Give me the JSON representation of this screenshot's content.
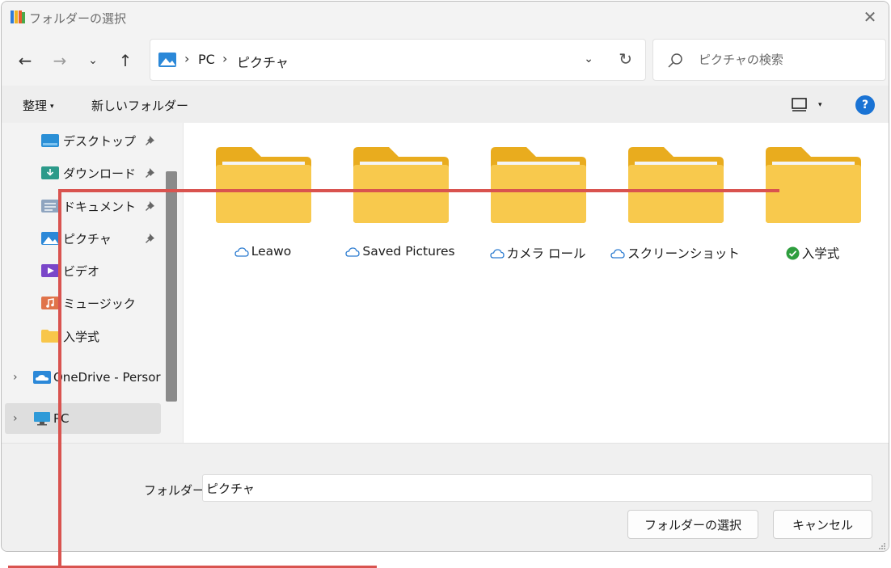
{
  "window": {
    "title": "フォルダーの選択",
    "close_glyph": "✕"
  },
  "nav": {
    "back_glyph": "←",
    "forward_glyph": "→",
    "recent_glyph": "⌄",
    "up_glyph": "↑",
    "breadcrumb": [
      "PC",
      "ピクチャ"
    ],
    "crumb_sep": "›",
    "dropdown_glyph": "⌄",
    "refresh_glyph": "↻",
    "search_placeholder": "ピクチャの検索"
  },
  "toolbar": {
    "organize_label": "整理",
    "organize_caret": "▾",
    "new_folder_label": "新しいフォルダー",
    "view_caret": "▾",
    "help_label": "?"
  },
  "sidebar": {
    "items": [
      {
        "label": "デスクトップ",
        "icon": "desktop-folder-icon",
        "pinned": true
      },
      {
        "label": "ダウンロード",
        "icon": "downloads-folder-icon",
        "pinned": true
      },
      {
        "label": "ドキュメント",
        "icon": "documents-folder-icon",
        "pinned": true
      },
      {
        "label": "ピクチャ",
        "icon": "pictures-folder-icon",
        "pinned": true
      },
      {
        "label": "ビデオ",
        "icon": "videos-folder-icon",
        "pinned": false
      },
      {
        "label": "ミュージック",
        "icon": "music-folder-icon",
        "pinned": false
      },
      {
        "label": "入学式",
        "icon": "folder-icon",
        "pinned": false
      },
      {
        "label": "OneDrive - Persor",
        "icon": "onedrive-icon",
        "pinned": false
      },
      {
        "label": "PC",
        "icon": "pc-icon",
        "pinned": false
      }
    ],
    "chevron_glyph": "›"
  },
  "folders": [
    {
      "name": "Leawo",
      "status": "cloud"
    },
    {
      "name": "Saved Pictures",
      "status": "cloud"
    },
    {
      "name": "カメラ ロール",
      "status": "cloud"
    },
    {
      "name": "スクリーンショット",
      "status": "cloud"
    },
    {
      "name": "入学式",
      "status": "synced"
    }
  ],
  "bottom": {
    "folder_label": "フォルダー:",
    "folder_value": "ピクチャ",
    "select_button": "フォルダーの選択",
    "cancel_button": "キャンセル"
  },
  "colors": {
    "accent": "#1a73d4",
    "folder_yellow": "#f8c64a",
    "annotation_red": "#d9534f",
    "synced_green": "#2e9e3e"
  }
}
